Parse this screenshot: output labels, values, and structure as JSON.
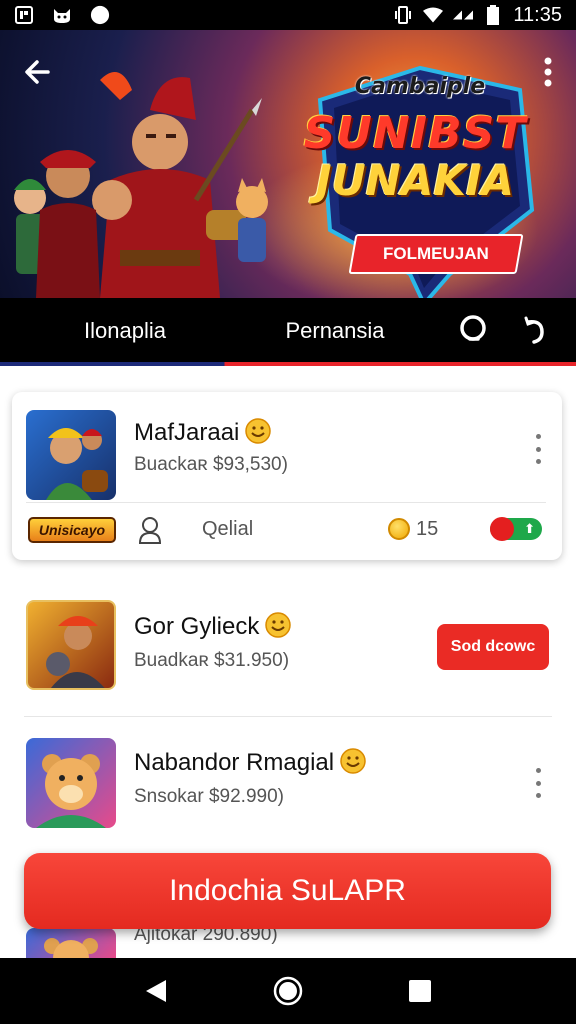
{
  "status_bar": {
    "time": "11:35",
    "icons": [
      "notification-icon",
      "cat-icon",
      "circle-icon",
      "vibrate-icon",
      "wifi-icon",
      "signal-icon",
      "battery-icon"
    ]
  },
  "hero": {
    "badge_line1": "Cambaiple",
    "badge_line2": "SUNIBST",
    "badge_line3": "JUNAKIA",
    "ribbon": "FOLMEUJAN",
    "icons": [
      "back-arrow-icon",
      "more-vertical-icon"
    ]
  },
  "tabs": [
    {
      "label": "Ilonaplia"
    },
    {
      "label": "Pernansia"
    }
  ],
  "tab_icons": [
    "search-icon",
    "refresh-icon"
  ],
  "items": [
    {
      "title": "MafJaraai",
      "subtitle": "Buackaʀ $93,530)",
      "footer": {
        "logo_text": "Unisicayo",
        "detail_label": "Qelial",
        "coin_count": "15"
      }
    },
    {
      "title": "Gor Gylieck",
      "subtitle": "Buadkaʀ $31.950)",
      "action_label": "Sod dcowc"
    },
    {
      "title": "Nabandor Rmagial",
      "subtitle": "Snsokar $92.990)"
    },
    {
      "subtitle": "Ajitokar 290.890)"
    }
  ],
  "cta": {
    "label": "Indochia SuLAPR"
  },
  "colors": {
    "accent": "#ea2b25",
    "tab_bar": "#000000",
    "tab_indicator_blue": "#1d2a7a",
    "toggle_green": "#1ea84a",
    "coin": "#f0a800"
  },
  "nav": [
    "back-triangle-icon",
    "home-circle-icon",
    "recents-square-icon"
  ]
}
